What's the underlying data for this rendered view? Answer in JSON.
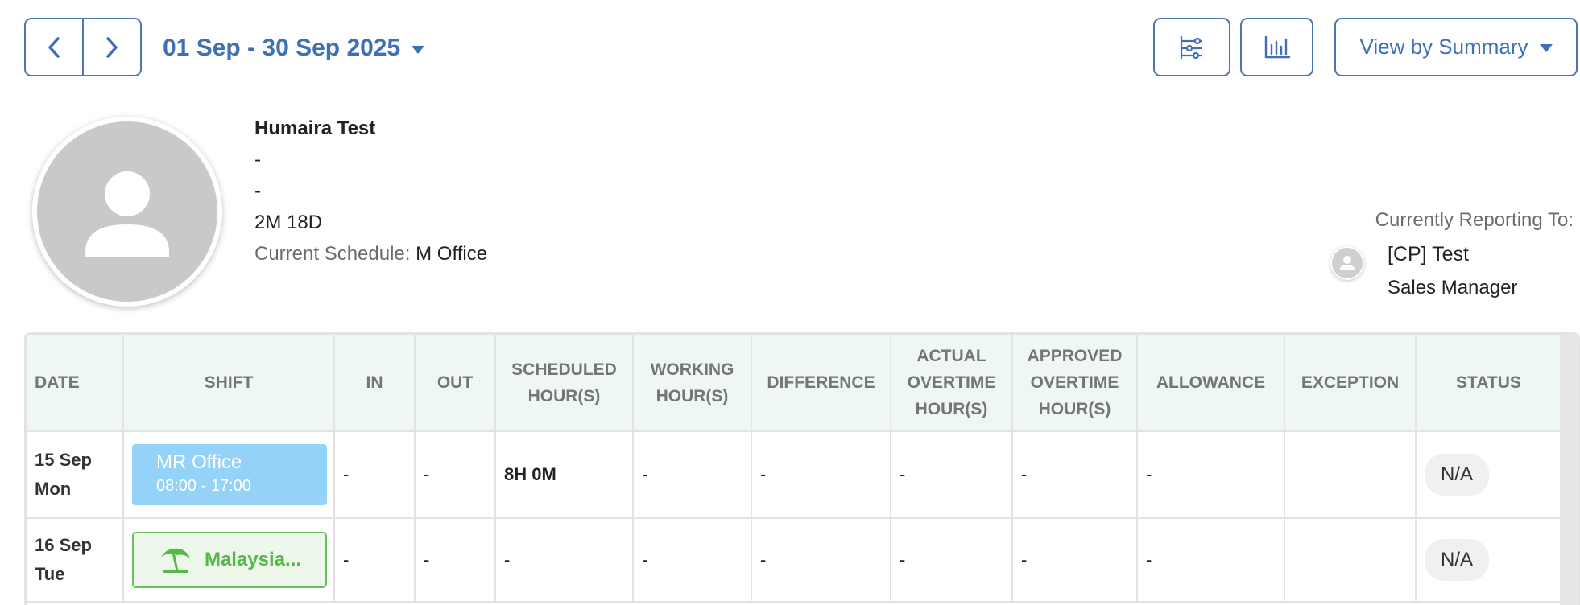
{
  "toolbar": {
    "date_range": "01 Sep - 30 Sep 2025",
    "view_label": "View by Summary",
    "icons": [
      "chevron-left-icon",
      "chevron-right-icon",
      "filter-sliders-icon",
      "bar-chart-icon",
      "chevron-down-icon"
    ]
  },
  "profile": {
    "name": "Humaira Test",
    "line2": "-",
    "line3": "-",
    "tenure": "2M 18D",
    "schedule_label": "Current Schedule:",
    "schedule_value": "M Office"
  },
  "reporting": {
    "label": "Currently Reporting To:",
    "name": "[CP] Test",
    "role": "Sales Manager"
  },
  "table": {
    "headers": [
      "DATE",
      "SHIFT",
      "IN",
      "OUT",
      "SCHEDULED HOUR(S)",
      "WORKING HOUR(S)",
      "DIFFERENCE",
      "ACTUAL OVERTIME HOUR(S)",
      "APPROVED OVERTIME HOUR(S)",
      "ALLOWANCE",
      "EXCEPTION",
      "STATUS"
    ],
    "rows": [
      {
        "date_day": "15 Sep",
        "date_weekday": "Mon",
        "shift_name": "MR Office",
        "shift_time": "08:00 - 17:00",
        "in": "-",
        "out": "-",
        "scheduled": "8H 0M",
        "working": "-",
        "difference": "-",
        "actual_ot": "-",
        "approved_ot": "-",
        "allowance": "-",
        "exception": "",
        "status": "N/A"
      },
      {
        "date_day": "16 Sep",
        "date_weekday": "Tue",
        "shift_name": "Malaysia...",
        "shift_time": "",
        "in": "-",
        "out": "-",
        "scheduled": "-",
        "working": "-",
        "difference": "-",
        "actual_ot": "-",
        "approved_ot": "-",
        "allowance": "-",
        "exception": "",
        "status": "N/A"
      }
    ]
  },
  "colors": {
    "accent": "#3e70b8",
    "header_bg": "#eef7f4",
    "shift_blue": "#94d3f7",
    "shift_green": "#56b84a"
  }
}
